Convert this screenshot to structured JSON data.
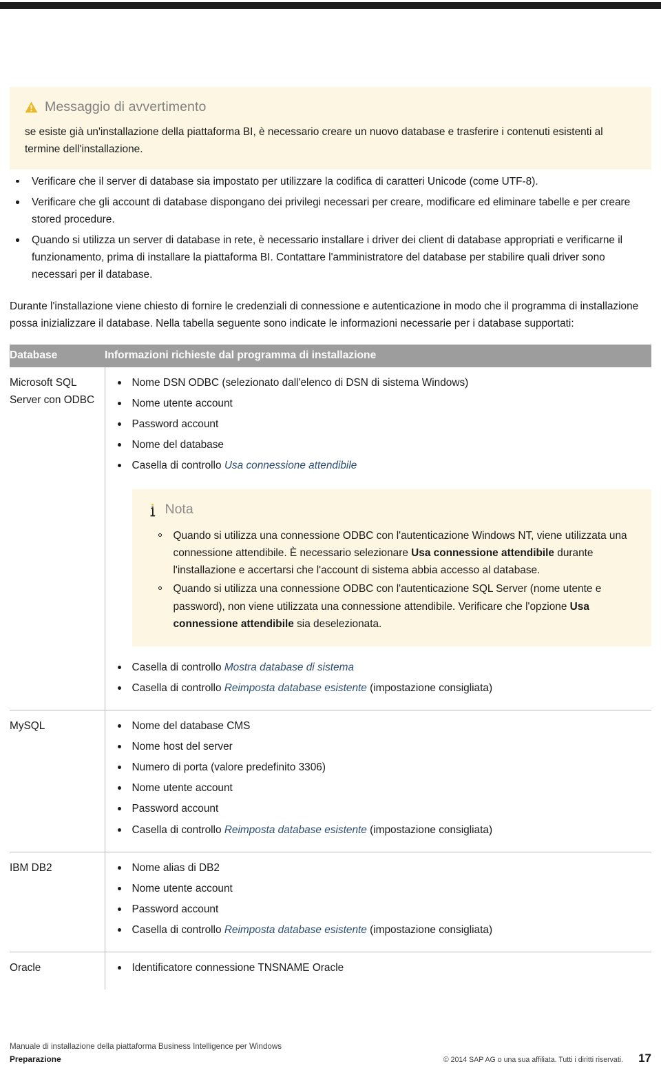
{
  "warning": {
    "icon": "warning-triangle-icon",
    "title": "Messaggio di avvertimento",
    "body": "se esiste già un'installazione della piattaforma BI, è necessario creare un nuovo database e trasferire i contenuti esistenti al termine dell'installazione."
  },
  "intro_bullets": [
    "Verificare che il server di database sia impostato per utilizzare la codifica di caratteri Unicode (come UTF-8).",
    "Verificare che gli account di database dispongano dei privilegi necessari per creare, modificare ed eliminare tabelle e per creare stored procedure.",
    "Quando si utilizza un server di database in rete, è necessario installare i driver dei client di database appropriati e verificarne il funzionamento, prima di installare la piattaforma BI. Contattare l'amministratore del database per stabilire quali driver sono necessari per il database."
  ],
  "paragraph": "Durante l'installazione viene chiesto di fornire le credenziali di connessione e autenticazione in modo che il programma di installazione possa inizializzare il database. Nella tabella seguente sono indicate le informazioni necessarie per i database supportati:",
  "table": {
    "headers": [
      "Database",
      "Informazioni richieste dal programma di installazione"
    ],
    "rows": [
      {
        "database": "Microsoft SQL Server con ODBC",
        "items_before_note": [
          {
            "text": "Nome DSN ODBC (selezionato dall'elenco di DSN di sistema Windows)"
          },
          {
            "text": "Nome utente account"
          },
          {
            "text": "Password account"
          },
          {
            "text": "Nome del database"
          },
          {
            "pre": "Casella di controllo ",
            "em": "Usa connessione attendibile",
            "post": ""
          }
        ],
        "note": {
          "icon": "info-icon",
          "title": "Nota",
          "items": [
            {
              "p1": "Quando si utilizza una connessione ODBC con l'autenticazione Windows NT, viene utilizzata una connessione attendibile. È necessario selezionare ",
              "b1": "Usa connessione attendibile",
              "p2": " durante l'installazione e accertarsi che l'account di sistema abbia accesso al database."
            },
            {
              "p1": "Quando si utilizza una connessione ODBC con l'autenticazione SQL Server (nome utente e password), non viene utilizzata una connessione attendibile. Verificare che l'opzione ",
              "b1": "Usa connessione attendibile",
              "p2": " sia deselezionata."
            }
          ]
        },
        "items_after_note": [
          {
            "pre": "Casella di controllo ",
            "em": "Mostra database di sistema",
            "post": ""
          },
          {
            "pre": "Casella di controllo ",
            "em": "Reimposta database esistente",
            "post": " (impostazione consigliata)"
          }
        ]
      },
      {
        "database": "MySQL",
        "items": [
          {
            "pre": "Nome del database CMS",
            "em": "",
            "post": ""
          },
          {
            "pre": "Nome host del server",
            "em": "",
            "post": ""
          },
          {
            "pre": "Numero di porta (valore predefinito 3306)",
            "em": "",
            "post": ""
          },
          {
            "pre": "Nome utente account",
            "em": "",
            "post": ""
          },
          {
            "pre": "Password account",
            "em": "",
            "post": ""
          },
          {
            "pre": "Casella di controllo ",
            "em": "Reimposta database esistente",
            "post": " (impostazione consigliata)"
          }
        ]
      },
      {
        "database": "IBM DB2",
        "items": [
          {
            "pre": "Nome alias di DB2",
            "em": "",
            "post": ""
          },
          {
            "pre": "Nome utente account",
            "em": "",
            "post": ""
          },
          {
            "pre": "Password account",
            "em": "",
            "post": ""
          },
          {
            "pre": "Casella di controllo ",
            "em": "Reimposta database esistente",
            "post": " (impostazione consigliata)"
          }
        ]
      },
      {
        "database": "Oracle",
        "items": [
          {
            "pre": "Identificatore connessione TNSNAME Oracle",
            "em": "",
            "post": ""
          }
        ]
      }
    ]
  },
  "footer": {
    "doc_title": "Manuale di installazione della piattaforma Business Intelligence per Windows",
    "section": "Preparazione",
    "copyright": "© 2014 SAP AG o una sua affiliata. Tutti i diritti riservati.",
    "page_number": "17"
  },
  "colors": {
    "callout_bg": "#fdf6e3",
    "warning_icon": "#e8b828",
    "table_header_bg": "#9d9d9d",
    "ui_term": "#2d4e73",
    "topbar": "#1d1d1d"
  }
}
